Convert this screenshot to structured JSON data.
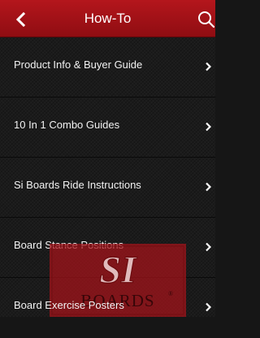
{
  "header": {
    "title": "How-To",
    "back_icon": "chevron-left-icon",
    "search_icon": "search-icon",
    "bar_color": "#a51218"
  },
  "menu": {
    "items": [
      {
        "label": "Product Info & Buyer Guide",
        "icon": "chevron-right-icon"
      },
      {
        "label": "10 In 1 Combo Guides",
        "icon": "chevron-right-icon"
      },
      {
        "label": "Si Boards Ride Instructions",
        "icon": "chevron-right-icon"
      },
      {
        "label": "Board Stance Positions",
        "icon": "chevron-right-icon"
      },
      {
        "label": "Board Exercise Posters",
        "icon": "chevron-right-icon"
      }
    ]
  },
  "watermark": {
    "line1": "SI",
    "line2": "BOARDS",
    "mark": "®"
  }
}
